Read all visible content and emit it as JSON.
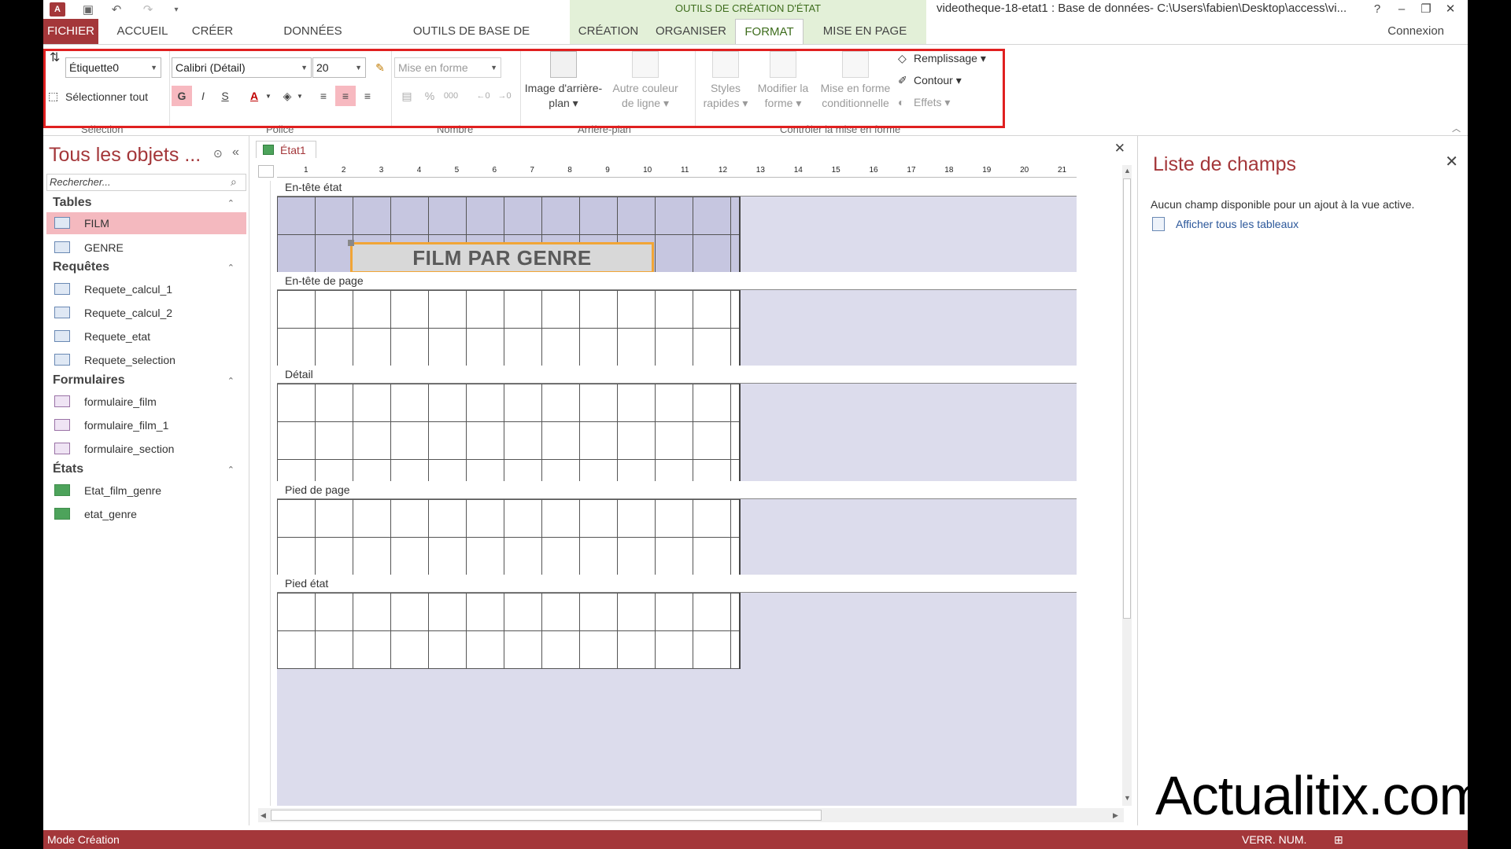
{
  "titlebar": {
    "app_logo": "A",
    "context_title": "OUTILS DE CRÉATION D'ÉTAT",
    "window_title": "videotheque-18-etat1 : Base de données- C:\\Users\\fabien\\Desktop\\access\\vi...",
    "help": "?",
    "minimize": "–",
    "restore": "❐",
    "close": "✕"
  },
  "tabs": {
    "fichier": "FICHIER",
    "accueil": "ACCUEIL",
    "creer": "CRÉER",
    "donnees_externes": "DONNÉES EXTERNES",
    "outils_bdd": "OUTILS DE BASE DE DONNÉES",
    "creation": "CRÉATION",
    "organiser": "ORGANISER",
    "format": "FORMAT",
    "mise_en_page": "MISE EN PAGE",
    "connexion": "Connexion"
  },
  "ribbon": {
    "selection_combo": "Étiquette0",
    "select_all": "Sélectionner tout",
    "font_combo": "Calibri (Détail)",
    "size_combo": "20",
    "format_combo": "Mise en forme",
    "bold": "G",
    "italic": "I",
    "underline": "S",
    "font_color": "A",
    "percent": "%",
    "thousands": "000",
    "bg_image_line1": "Image d'arrière-",
    "bg_image_line2": "plan ▾",
    "alt_color_line1": "Autre couleur",
    "alt_color_line2": "de ligne ▾",
    "quick_styles_line1": "Styles",
    "quick_styles_line2": "rapides ▾",
    "change_shape_line1": "Modifier la",
    "change_shape_line2": "forme ▾",
    "cond_format_line1": "Mise en forme",
    "cond_format_line2": "conditionnelle",
    "fill": "Remplissage ▾",
    "outline": "Contour ▾",
    "effects": "Effets ▾",
    "groups": {
      "selection": "Sélection",
      "police": "Police",
      "nombre": "Nombre",
      "arriere_plan": "Arrière-plan",
      "controle": "Contrôler la mise en forme"
    }
  },
  "nav": {
    "title": "Tous les objets ...",
    "search_placeholder": "Rechercher...",
    "groups": [
      {
        "label": "Tables",
        "items": [
          "FILM",
          "GENRE"
        ]
      },
      {
        "label": "Requêtes",
        "items": [
          "Requete_calcul_1",
          "Requete_calcul_2",
          "Requete_etat",
          "Requete_selection"
        ]
      },
      {
        "label": "Formulaires",
        "items": [
          "formulaire_film",
          "formulaire_film_1",
          "formulaire_section"
        ]
      },
      {
        "label": "États",
        "items": [
          "Etat_film_genre",
          "etat_genre"
        ]
      }
    ],
    "selected_item": "FILM"
  },
  "document": {
    "tab_label": "État1",
    "ruler_marks": [
      "1",
      "2",
      "3",
      "4",
      "5",
      "6",
      "7",
      "8",
      "9",
      "10",
      "11",
      "12",
      "13",
      "14",
      "15",
      "16",
      "17",
      "18",
      "19",
      "20",
      "21"
    ],
    "sections": [
      "En-tête état",
      "En-tête de page",
      "Détail",
      "Pied de page",
      "Pied état"
    ],
    "title_label": "FILM PAR GENRE"
  },
  "field_list": {
    "title": "Liste de champs",
    "message": "Aucun champ disponible pour un ajout à la vue active.",
    "link": "Afficher tous les tableaux"
  },
  "statusbar": {
    "mode": "Mode Création",
    "numlock": "VERR. NUM."
  },
  "watermark": "Actualitix.com",
  "colors": {
    "access_red": "#a4373a",
    "context_green": "#e3f0d8",
    "highlight_red": "#e02020",
    "selection_orange": "#f1a536"
  }
}
